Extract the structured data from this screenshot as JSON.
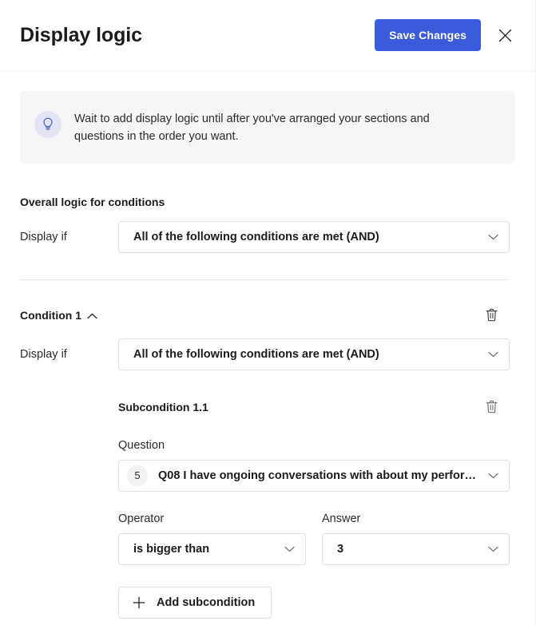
{
  "header": {
    "title": "Display logic",
    "save_label": "Save Changes",
    "close_icon": "close-icon",
    "accent_color": "#3A5BDB"
  },
  "tip": {
    "icon": "lightbulb-icon",
    "text": "Wait to add display logic until after you've arranged your sections and questions in the order you want.",
    "background": "#f6f6f6",
    "icon_background": "#e3e5f4",
    "icon_color": "#4a5fc1"
  },
  "overall": {
    "section_title": "Overall logic for conditions",
    "display_if_label": "Display if",
    "display_if_value": "All of the following conditions are met (AND)"
  },
  "condition": {
    "title": "Condition 1",
    "collapse_icon": "chevron-up-icon",
    "delete_icon": "trash-icon",
    "display_if_label": "Display if",
    "display_if_value": "All of the following conditions are met (AND)",
    "subcondition": {
      "title": "Subcondition 1.1",
      "delete_icon": "trash-icon",
      "question_label": "Question",
      "question_badge": "5",
      "question_value": "Q08 I have ongoing conversations with about my performan...",
      "operator_label": "Operator",
      "operator_value": "is bigger than",
      "answer_label": "Answer",
      "answer_value": "3"
    },
    "add_subcondition_label": "Add subcondition",
    "add_icon": "plus-icon"
  }
}
